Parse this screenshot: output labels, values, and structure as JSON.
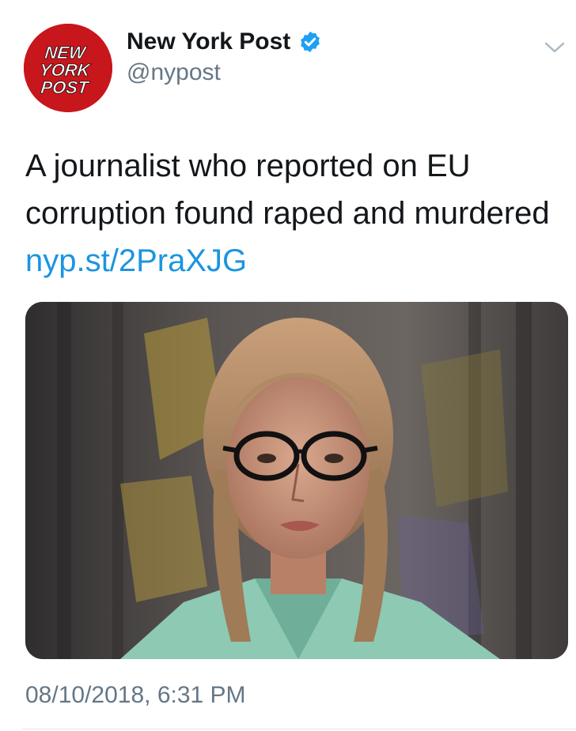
{
  "account": {
    "name": "New York Post",
    "handle": "@nypost",
    "verified": true,
    "avatar_logo_lines": [
      "NEW",
      "YORK",
      "POST"
    ]
  },
  "tweet": {
    "text_before_link": "A journalist who reported on EU corruption found raped and murdered ",
    "link": "nyp.st/2PraXJG",
    "timestamp": "08/10/2018, 6:31 PM"
  },
  "icons": {
    "verified": "verified-badge-icon",
    "menu": "chevron-down-icon"
  },
  "colors": {
    "link": "#1b95e0",
    "secondary_text": "#657786",
    "verified": "#1da1f2",
    "avatar_red": "#c8161d"
  }
}
